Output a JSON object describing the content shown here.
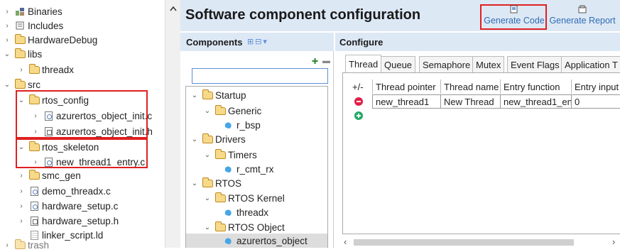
{
  "project_tree": {
    "items": [
      {
        "label": "Binaries",
        "icon": "binaries-icon",
        "chevron": "›"
      },
      {
        "label": "Includes",
        "icon": "includes-icon",
        "chevron": "›"
      },
      {
        "label": "HardwareDebug",
        "icon": "folder-icon",
        "chevron": "›"
      },
      {
        "label": "libs",
        "icon": "folder-icon",
        "chevron": "⌄"
      },
      {
        "label": "threadx",
        "icon": "folder-icon",
        "chevron": "›"
      },
      {
        "label": "src",
        "icon": "folder-icon",
        "chevron": "⌄"
      },
      {
        "label": "rtos_config",
        "icon": "folder-icon",
        "chevron": "⌄"
      },
      {
        "label": "azurertos_object_init.c",
        "icon": "c-file-icon",
        "chevron": "›"
      },
      {
        "label": "azurertos_object_init.h",
        "icon": "h-file-icon",
        "chevron": "›"
      },
      {
        "label": "rtos_skeleton",
        "icon": "folder-icon",
        "chevron": "⌄"
      },
      {
        "label": "new_thread1_entry.c",
        "icon": "c-file-icon",
        "chevron": "›"
      },
      {
        "label": "smc_gen",
        "icon": "folder-icon",
        "chevron": "›"
      },
      {
        "label": "demo_threadx.c",
        "icon": "c-file-icon",
        "chevron": "›"
      },
      {
        "label": "hardware_setup.c",
        "icon": "c-file-icon",
        "chevron": "›"
      },
      {
        "label": "hardware_setup.h",
        "icon": "h-file-icon",
        "chevron": "›"
      },
      {
        "label": "linker_script.ld",
        "icon": "plain-file-icon",
        "chevron": ""
      },
      {
        "label": "trash",
        "icon": "trash-folder-icon",
        "chevron": "›"
      }
    ]
  },
  "configurator": {
    "title": "Software component configuration",
    "generate_code": "Generate Code",
    "generate_report": "Generate Report",
    "components_header": "Components",
    "configure_header": "Configure",
    "search_value": "",
    "tree": [
      {
        "label": "Startup",
        "kind": "folder",
        "chevron": "⌄"
      },
      {
        "label": "Generic",
        "kind": "folder",
        "chevron": "⌄"
      },
      {
        "label": "r_bsp",
        "kind": "component",
        "chevron": ""
      },
      {
        "label": "Drivers",
        "kind": "folder",
        "chevron": "⌄"
      },
      {
        "label": "Timers",
        "kind": "folder",
        "chevron": "⌄"
      },
      {
        "label": "r_cmt_rx",
        "kind": "component",
        "chevron": ""
      },
      {
        "label": "RTOS",
        "kind": "folder",
        "chevron": "⌄"
      },
      {
        "label": "RTOS Kernel",
        "kind": "folder",
        "chevron": "⌄"
      },
      {
        "label": "threadx",
        "kind": "component",
        "chevron": ""
      },
      {
        "label": "RTOS Object",
        "kind": "folder",
        "chevron": "⌄"
      },
      {
        "label": "azurertos_object",
        "kind": "component",
        "chevron": ""
      }
    ],
    "tabs": [
      "Thread",
      "Queue",
      "Semaphore",
      "Mutex",
      "Event Flags",
      "Application T"
    ],
    "table": {
      "headers": [
        "+/-",
        "Thread pointer",
        "Thread name",
        "Entry function",
        "Entry input"
      ],
      "rows": [
        [
          "",
          "new_thread1",
          "New Thread",
          "new_thread1_en",
          "0"
        ]
      ]
    },
    "colors": {
      "accent": "#2f6db5",
      "header_bg": "#dde8f5",
      "highlight": "#e02020",
      "remove": "#e0204a",
      "add": "#22aa66"
    }
  }
}
